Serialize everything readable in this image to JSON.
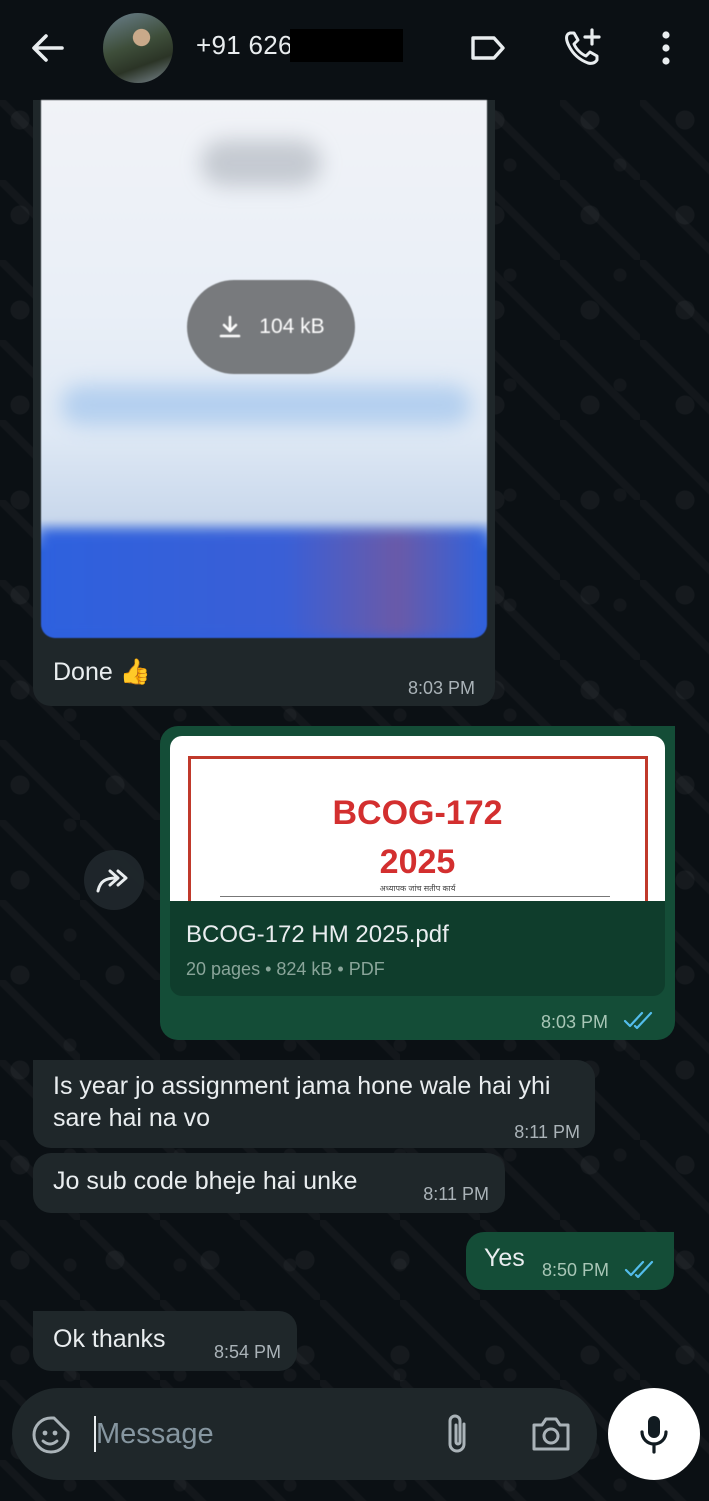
{
  "header": {
    "contact_name": "+91 626",
    "icons": [
      "back-arrow-icon",
      "label-icon",
      "add-call-icon",
      "more-vertical-icon"
    ]
  },
  "messages": [
    {
      "direction": "in",
      "type": "image",
      "download_size": "104 kB",
      "caption": "Done 👍",
      "time": "8:03 PM"
    },
    {
      "direction": "out",
      "type": "document",
      "thumb_title_line1": "BCOG-172",
      "thumb_title_line2": "2025",
      "thumb_subtitle": "अध्यापक जांच सतीप कार्य",
      "file_name": "BCOG-172 HM 2025.pdf",
      "file_meta": "20 pages • 824 kB • PDF",
      "time": "8:03 PM",
      "status": "read"
    },
    {
      "direction": "in",
      "type": "text",
      "text": "Is year jo assignment jama hone wale hai yhi sare hai na vo",
      "time": "8:11 PM"
    },
    {
      "direction": "in",
      "type": "text",
      "text": "Jo sub code bheje hai unke",
      "time": "8:11 PM"
    },
    {
      "direction": "out",
      "type": "text",
      "text": "Yes",
      "time": "8:50 PM",
      "status": "read"
    },
    {
      "direction": "in",
      "type": "text",
      "text": "Ok thanks",
      "time": "8:54 PM"
    }
  ],
  "composer": {
    "placeholder": "Message",
    "icons": [
      "sticker-icon",
      "attach-icon",
      "camera-icon",
      "mic-icon"
    ]
  },
  "colors": {
    "background": "#0b1014",
    "incoming_bubble": "#1f272a",
    "outgoing_bubble": "#144d37",
    "read_ticks": "#53bdeb"
  }
}
